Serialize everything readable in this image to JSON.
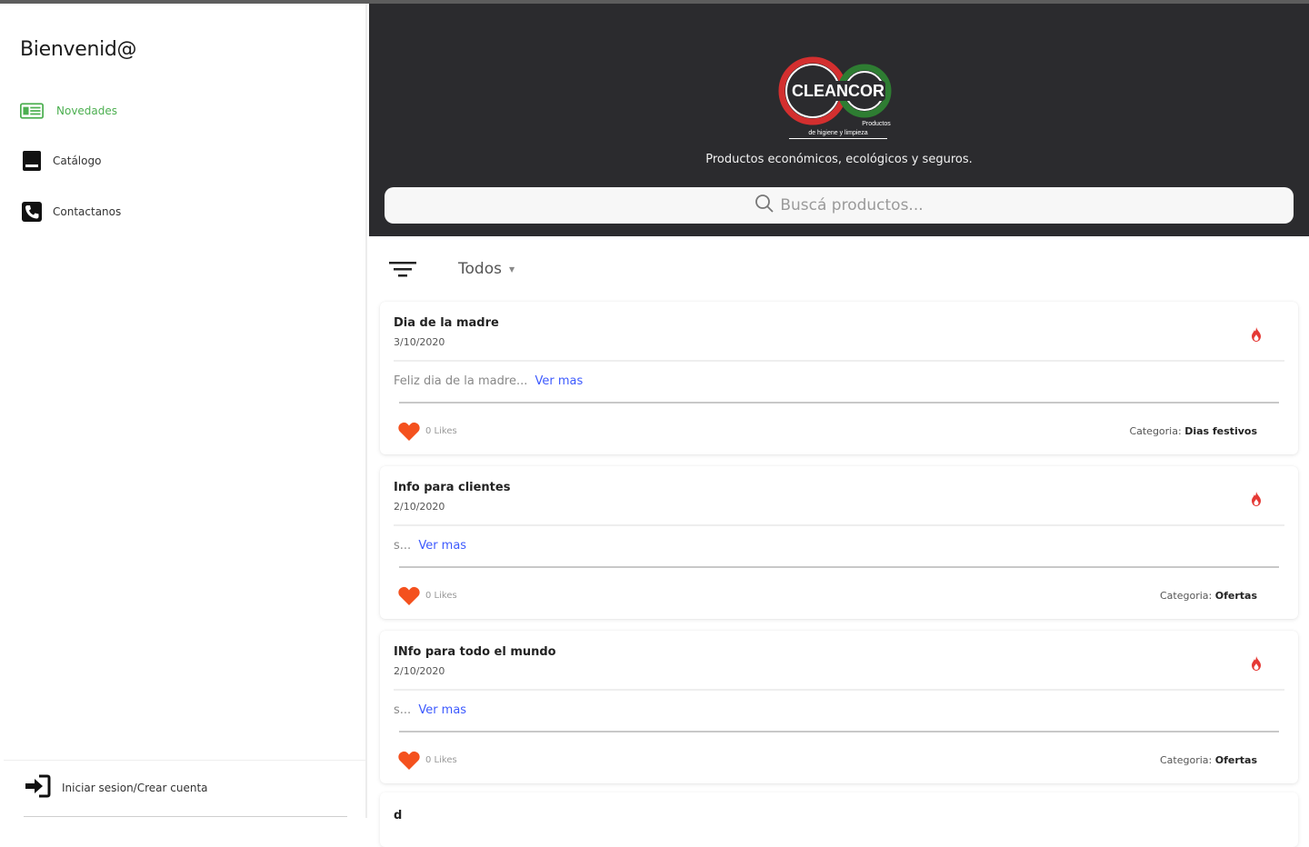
{
  "sidebar": {
    "welcome": "Bienvenid@",
    "items": [
      {
        "label": "Novedades",
        "icon": "newspaper-icon",
        "active": true
      },
      {
        "label": "Catálogo",
        "icon": "book-icon",
        "active": false
      },
      {
        "label": "Contactanos",
        "icon": "phone-icon",
        "active": false
      }
    ],
    "login_label": "Iniciar sesion/Crear cuenta",
    "login_icon": "sign-in-icon"
  },
  "header": {
    "logo_text": "CLEANCOR",
    "logo_sub_1": "Productos",
    "logo_sub_2": "de higiene y limpieza",
    "tagline": "Productos económicos, ecológicos y seguros.",
    "search_placeholder": "Buscá productos..."
  },
  "filter": {
    "selected": "Todos"
  },
  "posts": [
    {
      "title": "Dia de la madre",
      "date": "3/10/2020",
      "excerpt": "Feliz dia de la madre...",
      "more": "Ver mas",
      "likes": "0 Likes",
      "category_label": "Categoria:",
      "category": "Dias festivos"
    },
    {
      "title": "Info para clientes",
      "date": "2/10/2020",
      "excerpt": "s...",
      "more": "Ver mas",
      "likes": "0 Likes",
      "category_label": "Categoria:",
      "category": "Ofertas"
    },
    {
      "title": "INfo para todo el mundo",
      "date": "2/10/2020",
      "excerpt": "s...",
      "more": "Ver mas",
      "likes": "0 Likes",
      "category_label": "Categoria:",
      "category": "Ofertas"
    },
    {
      "title": "d"
    }
  ],
  "colors": {
    "accent_green": "#4caf50",
    "header_bg": "#2b2b2e",
    "like_heart": "#f4511e",
    "fire_icon": "#e53935",
    "link_blue": "#3d5afe",
    "logo_red": "#d32f2f",
    "logo_green": "#2e7d32"
  }
}
